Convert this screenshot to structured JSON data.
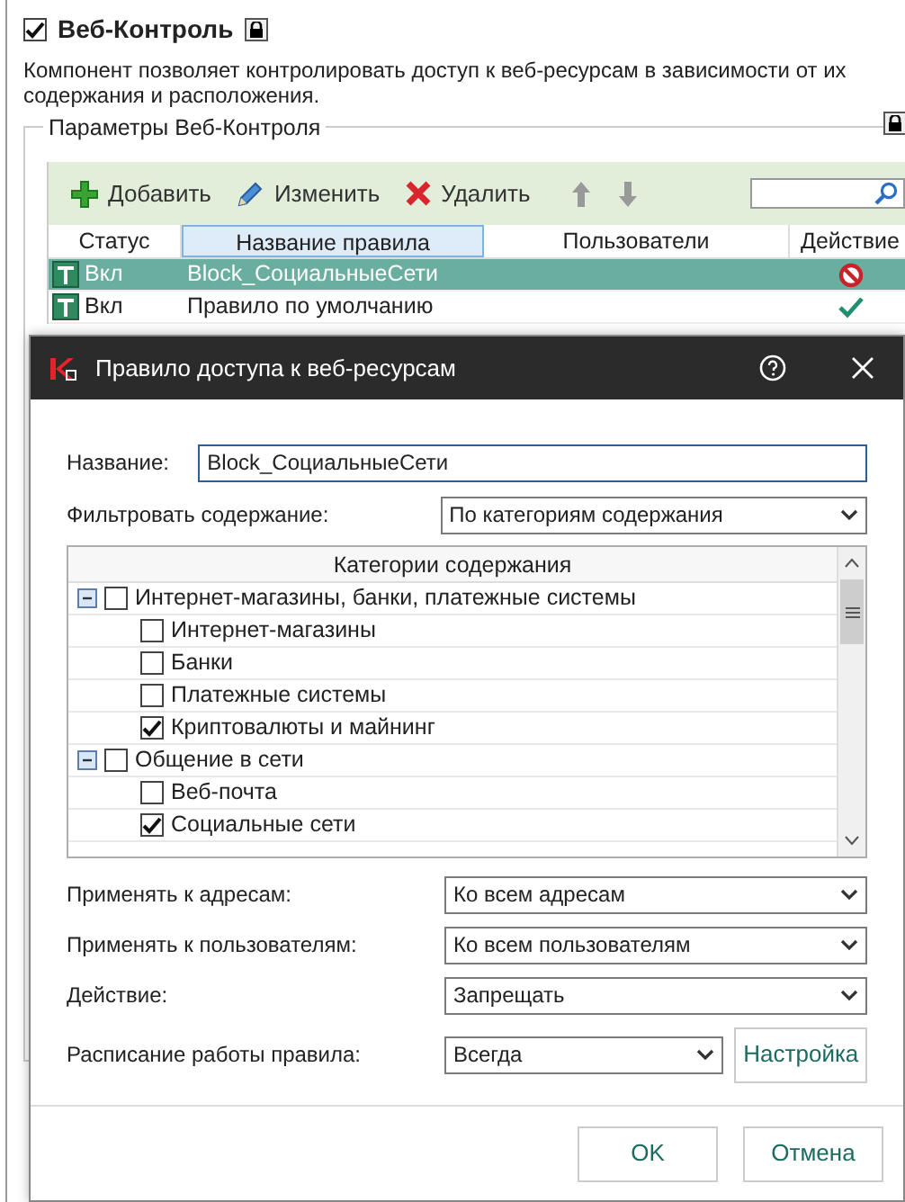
{
  "component": {
    "title": "Веб-Контроль",
    "enabled": true,
    "locked": true,
    "description": "Компонент позволяет контролировать доступ к веб-ресурсам в зависимости от их содержания и расположения."
  },
  "group": {
    "title": "Параметры Веб-Контроля",
    "locked": true
  },
  "toolbar": [
    {
      "kind": "add",
      "label": "Добавить"
    },
    {
      "kind": "edit",
      "label": "Изменить"
    },
    {
      "kind": "delete",
      "label": "Удалить"
    },
    {
      "kind": "up"
    },
    {
      "kind": "down"
    }
  ],
  "rules_table": {
    "columns": [
      {
        "label": "Статус",
        "selected": false
      },
      {
        "label": "Название правила",
        "selected": true
      },
      {
        "label": "Пользователи",
        "selected": false
      },
      {
        "label": "Действие",
        "selected": false
      }
    ],
    "rows": [
      {
        "status": "Вкл",
        "name": "Block_СоциальныеСети",
        "kind": "block",
        "selected": true
      },
      {
        "status": "Вкл",
        "name": "Правило по умолчанию",
        "kind": "allow",
        "selected": false
      }
    ]
  },
  "dialog": {
    "title": "Правило доступа к веб-ресурсам",
    "name_label": "Название:",
    "name_value": "Block_СоциальныеСети",
    "filter_label": "Фильтровать содержание:",
    "filter_value": "По категориям содержания",
    "categories": {
      "header": "Категории содержания",
      "items": [
        {
          "label": "Интернет-магазины, банки, платежные системы",
          "checked": false,
          "expanded": true,
          "children": [
            {
              "label": "Интернет-магазины",
              "checked": false
            },
            {
              "label": "Банки",
              "checked": false
            },
            {
              "label": "Платежные системы",
              "checked": false
            },
            {
              "label": "Криптовалюты и майнинг",
              "checked": true
            }
          ]
        },
        {
          "label": "Общение в сети",
          "checked": false,
          "expanded": true,
          "children": [
            {
              "label": "Веб-почта",
              "checked": false
            },
            {
              "label": "Социальные сети",
              "checked": true
            }
          ]
        }
      ]
    },
    "settings": [
      {
        "label": "Применять к адресам:",
        "value": "Ко всем адресам"
      },
      {
        "label": "Применять к пользователям:",
        "value": "Ко всем пользователям"
      },
      {
        "label": "Действие:",
        "value": "Запрещать"
      },
      {
        "label": "Расписание работы правила:",
        "value": "Всегда",
        "button": "Настройка"
      }
    ],
    "buttons": [
      "OK",
      "Отмена"
    ]
  }
}
